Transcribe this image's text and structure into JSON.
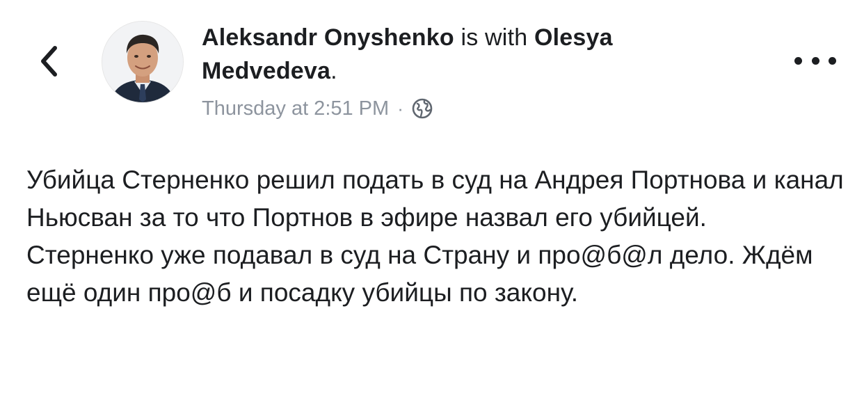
{
  "header": {
    "author": "Aleksandr  Onyshenko",
    "with_text": " is with ",
    "tagged": "Olesya",
    "tagged_line2": "Medvedeva",
    "period": ".",
    "timestamp": "Thursday at 2:51 PM",
    "separator": "·"
  },
  "icons": {
    "back": "chevron-left-icon",
    "privacy": "globe-icon",
    "more": "more-dots-icon",
    "avatar": "profile-photo"
  },
  "post": {
    "paragraph1": "Убийца Стерненко решил подать в суд на Андрея Портнова и канал Ньюсван за то что Портнов в эфире назвал его убийцей.",
    "paragraph2": "Стерненко уже подавал в суд на Страну и про@б@л дело. Ждём ещё один про@б и посадку убийцы по закону."
  }
}
